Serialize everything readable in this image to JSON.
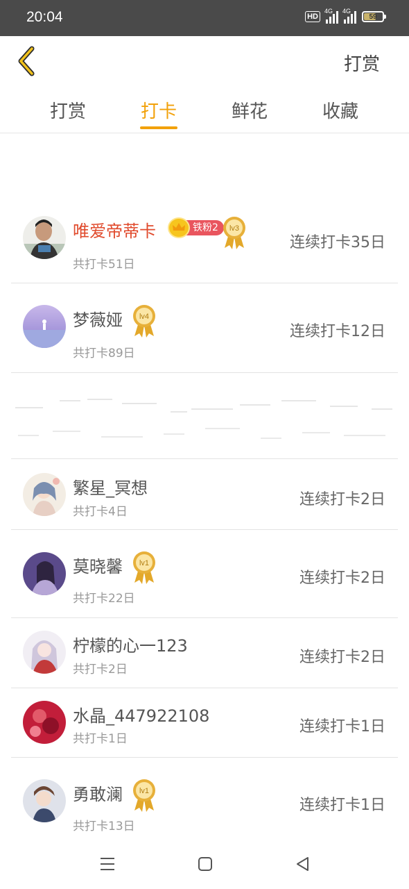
{
  "status_bar": {
    "time": "20:04",
    "hd_label": "HD",
    "network_1": "4G",
    "network_2": "4G",
    "battery": "59",
    "battery_level": 0.59
  },
  "header": {
    "back_icon": "chevron-left-icon",
    "action_label": "打赏"
  },
  "tabs": [
    {
      "label": "打赏",
      "active": false
    },
    {
      "label": "打卡",
      "active": true
    },
    {
      "label": "鲜花",
      "active": false
    },
    {
      "label": "收藏",
      "active": false
    }
  ],
  "accent_color": "#f2a10a",
  "vip_name_color": "#e04a2c",
  "entries": [
    {
      "name": "唯爱帝蒂卡",
      "total": "共打卡51日",
      "streak": "连续打卡35日",
      "level": "lv3",
      "fan_badge": "铁粉2"
    },
    {
      "name": "梦薇娅",
      "total": "共打卡89日",
      "streak": "连续打卡12日",
      "level": "lv4"
    },
    {
      "name": "繁星_冥想",
      "total": "共打卡4日",
      "streak": "连续打卡2日"
    },
    {
      "name": "莫晓馨",
      "total": "共打卡22日",
      "streak": "连续打卡2日",
      "level": "lv1"
    },
    {
      "name": "柠檬的心一123",
      "total": "共打卡2日",
      "streak": "连续打卡2日"
    },
    {
      "name": "水晶_447922108",
      "total": "共打卡1日",
      "streak": "连续打卡1日"
    },
    {
      "name": "勇敢澜",
      "total": "共打卡13日",
      "streak": "连续打卡1日",
      "level": "lv1"
    }
  ],
  "bottom_nav": {
    "menu_icon": "menu-icon",
    "home_icon": "home-square-icon",
    "back_icon": "back-triangle-icon"
  }
}
